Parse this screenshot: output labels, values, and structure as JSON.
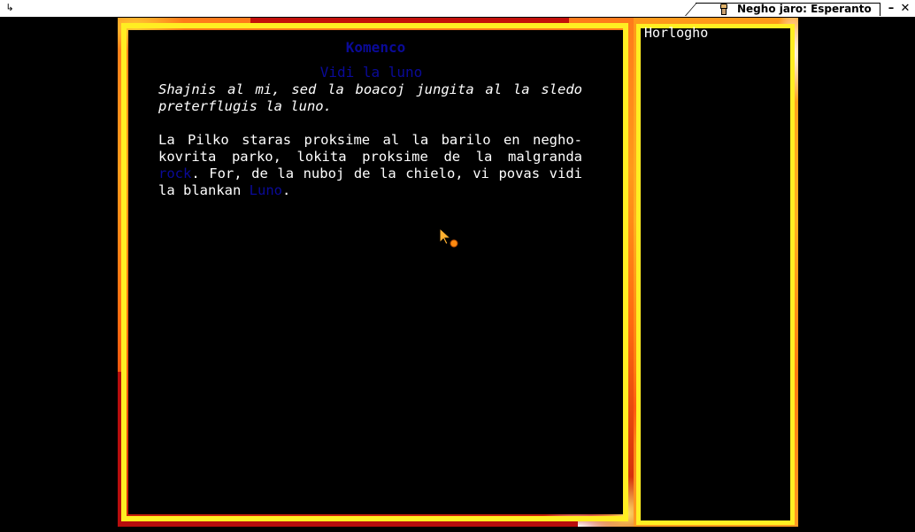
{
  "window": {
    "title": "Negho jaro: Esperanto",
    "menu_icon": "arrow-menu-icon",
    "app_icon": "person-icon",
    "minimize_label": "–",
    "close_label": "✕"
  },
  "story": {
    "heading": "Komenco",
    "scene_title": "Vidi la luno",
    "intro": "Shajnis al mi, sed la boacoj jungita al la sledo preterflugis la luno.",
    "para_part1": "La Pilko staras proksime al la barilo en negho-kovrita parko, lokita proksime de la malgranda ",
    "link1": "rock",
    "para_part2": ". For, de la nuboj de la chielo, vi povas vidi la blankan ",
    "link2": "Luno",
    "para_part3": "."
  },
  "sidebar": {
    "title": "Horlogho"
  },
  "colors": {
    "link": "#0a0a99",
    "text": "#ffffff",
    "background": "#000000",
    "frame_fire": "#ff8a1a",
    "frame_inner": "#ffee22"
  }
}
